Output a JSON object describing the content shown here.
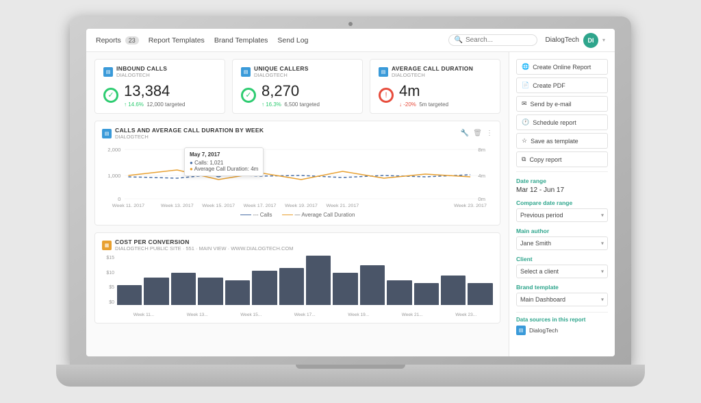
{
  "navbar": {
    "reports_label": "Reports",
    "reports_count": "23",
    "report_templates_label": "Report Templates",
    "brand_templates_label": "Brand Templates",
    "send_log_label": "Send Log",
    "search_placeholder": "Search...",
    "user_name": "DialogTech",
    "user_initials": "DI"
  },
  "kpi": {
    "cards": [
      {
        "icon": "▤",
        "title": "INBOUND CALLS",
        "sub": "DIALOGTECH",
        "value": "13,384",
        "status": "green",
        "detail_pct": "↑ 14.6%",
        "detail_pct_dir": "up",
        "detail_target": "12,000 targeted"
      },
      {
        "icon": "▤",
        "title": "UNIQUE CALLERS",
        "sub": "DIALOGTECH",
        "value": "8,270",
        "status": "green",
        "detail_pct": "↑ 16.3%",
        "detail_pct_dir": "up",
        "detail_target": "6,500 targeted"
      },
      {
        "icon": "▤",
        "title": "AVERAGE CALL DURATION",
        "sub": "DIALOGTECH",
        "value": "4m",
        "status": "red",
        "detail_pct": "↓ -20%",
        "detail_pct_dir": "down",
        "detail_target": "5m targeted"
      }
    ]
  },
  "line_chart": {
    "title": "CALLS AND AVERAGE CALL DURATION BY WEEK",
    "sub": "DIALOGTECH",
    "tooltip": {
      "date": "May 7, 2017",
      "calls_label": "Calls:",
      "calls_value": "1,021",
      "avg_label": "Average Call Duration:",
      "avg_value": "4m"
    },
    "x_labels": [
      "Week 11, 2017",
      "Week 13, 2017",
      "Week 15, 2017",
      "Week 17, 2017",
      "Week 19, 2017",
      "Week 21, 2017",
      "Week 23, 2017"
    ],
    "y_labels": [
      "2,000",
      "1,000",
      "0"
    ],
    "y_right_labels": [
      "8m",
      "4m",
      "0m"
    ],
    "legend_calls": "--- Calls",
    "legend_avg": "— Average Call Duration"
  },
  "bar_chart": {
    "title": "COST PER CONVERSION",
    "sub": "DIALOGTECH PUBLIC SITE · 551 · MAIN VIEW · WWW.DIALOGTECH.COM",
    "y_labels": [
      "$15",
      "$10",
      "$5",
      "$0"
    ],
    "x_labels": [
      "Week 11...",
      "Week 13...",
      "Week 15...",
      "Week 17...",
      "Week 19...",
      "Week 21...",
      "Week 23..."
    ],
    "bars": [
      40,
      55,
      65,
      55,
      50,
      70,
      75,
      100,
      65,
      80,
      50,
      45,
      60,
      45
    ]
  },
  "sidebar": {
    "create_online_label": "Create Online Report",
    "create_pdf_label": "Create PDF",
    "send_email_label": "Send by e-mail",
    "schedule_label": "Schedule report",
    "save_template_label": "Save as template",
    "copy_label": "Copy report",
    "date_range_label": "Date range",
    "date_range_value": "Mar 12 - Jun 17",
    "compare_range_label": "Compare date range",
    "compare_range_value": "Previous period",
    "author_label": "Main author",
    "author_value": "Jane Smith",
    "client_label": "Client",
    "client_placeholder": "Select a client",
    "brand_template_label": "Brand template",
    "brand_template_value": "Main Dashboard",
    "data_sources_label": "Data sources in this report",
    "data_source_name": "DialogTech"
  }
}
